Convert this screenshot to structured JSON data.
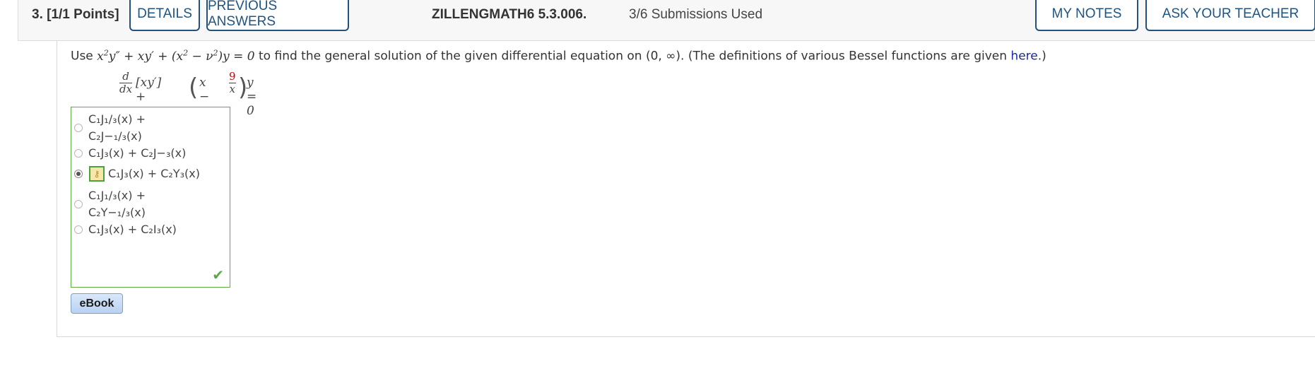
{
  "header": {
    "question_label": "3.  [1/1 Points]",
    "details_label": "DETAILS",
    "previous_answers_label": "PREVIOUS ANSWERS",
    "problem_code": "ZILLENGMATH6 5.3.006.",
    "submissions": "3/6 Submissions Used",
    "my_notes_label": "MY NOTES",
    "ask_teacher_label": "ASK YOUR TEACHER"
  },
  "question": {
    "prefix": "Use",
    "suffix": "to find the general solution of the given differential equation on (0, ∞). (The definitions of various Bessel functions are given",
    "link_text": "here",
    "end": ".)",
    "equation_d": "d",
    "equation_dx": "dx",
    "equation_bracket": "[xy′] +",
    "equation_x": "x −",
    "equation_num": "9",
    "equation_den": "x",
    "equation_tail": "y = 0"
  },
  "answers": [
    {
      "lines": [
        "C₁J₁/₃(x) +",
        "C₂J−₁/₃(x)"
      ],
      "selected": false
    },
    {
      "lines": [
        "C₁J₃(x) + C₂J−₃(x)"
      ],
      "selected": false
    },
    {
      "lines": [
        "C₁J₃(x) + C₂Y₃(x)"
      ],
      "selected": true
    },
    {
      "lines": [
        "C₁J₁/₃(x) +",
        "C₂Y−₁/₃(x)"
      ],
      "selected": false
    },
    {
      "lines": [
        "C₁J₃(x) + C₂I₃(x)"
      ],
      "selected": false
    }
  ],
  "ebook_label": "eBook",
  "colors": {
    "accent": "#1f5482",
    "correct": "#5dae3f",
    "link": "#1a2aa8"
  }
}
